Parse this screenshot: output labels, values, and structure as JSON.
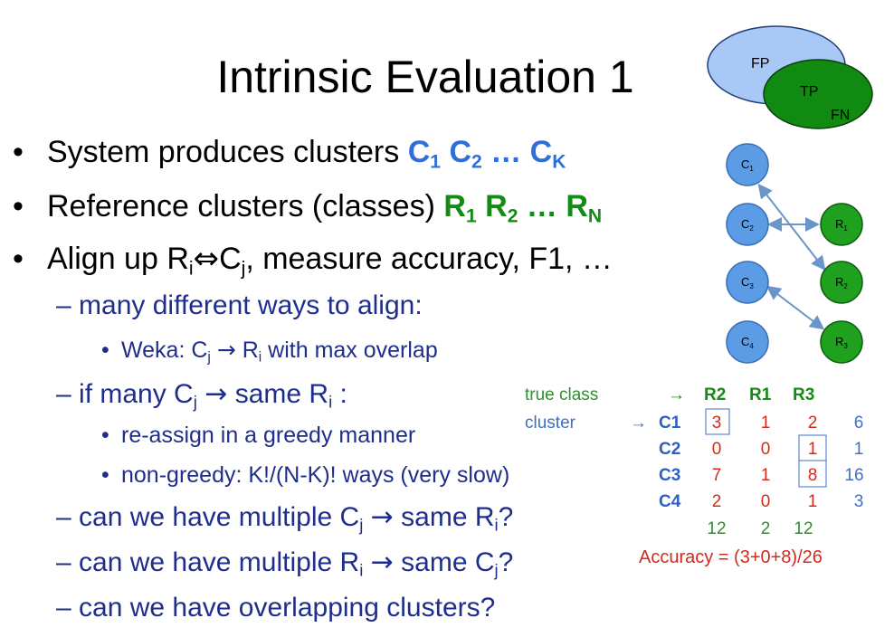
{
  "title": "Intrinsic Evaluation 1",
  "bullets": {
    "b1": {
      "text": "System produces clusters ",
      "c1": "C",
      "s1": "1",
      "c2": "C",
      "s2": "2",
      "ell": "…",
      "ck": "C",
      "sk": "K"
    },
    "b2": {
      "text": "Reference clusters (classes) ",
      "r1": "R",
      "s1": "1",
      "r2": "R",
      "s2": "2",
      "ell": "…",
      "rn": "R",
      "sn": "N"
    },
    "b3": {
      "pre": "Align up R",
      "si": "i",
      "arrow": "⇔",
      "c": "C",
      "sj": "j",
      "post": ", measure accuracy, F1, …"
    },
    "s1": {
      "text": "many different ways to align:"
    },
    "s1a": {
      "pre": "Weka: C",
      "sj": "j",
      "arrow": "→",
      "mid": " R",
      "si": "i",
      "post": " with max overlap"
    },
    "s2": {
      "pre": "if many C",
      "sj": "j",
      "arrow": "→",
      "mid": " same R",
      "si": "i",
      "post": " :"
    },
    "s2a": {
      "text": "re-assign in a greedy manner"
    },
    "s2b": {
      "text": "non-greedy: K!/(N-K)! ways (very slow)"
    },
    "s3": {
      "pre": "can we have multiple C",
      "sj": "j",
      "arrow": "→",
      "mid": " same R",
      "si": "i",
      "post": "?"
    },
    "s4": {
      "pre": "can we have multiple R",
      "si": "i",
      "arrow": "→",
      "mid": " same C",
      "sj": "j",
      "post": "?"
    },
    "s5": {
      "text": "can we have overlapping clusters?"
    }
  },
  "venn": {
    "fp": "FP",
    "tp": "TP",
    "fn": "FN"
  },
  "graph": {
    "c_nodes": [
      "C",
      "C",
      "C",
      "C"
    ],
    "c_subs": [
      "1",
      "2",
      "3",
      "4"
    ],
    "r_nodes": [
      "R",
      "R",
      "R"
    ],
    "r_subs": [
      "1",
      "2",
      "3"
    ],
    "colors": {
      "c_fill": "#5b9ce4",
      "r_fill": "#1fa01f",
      "edge": "#6a95c8"
    }
  },
  "table": {
    "header_label": "true class",
    "header_arrow": "→",
    "row_label": "cluster",
    "row_arrow": "→",
    "cols": [
      "R2",
      "R1",
      "R3"
    ],
    "rows": [
      {
        "name": "C1",
        "vals": [
          "3",
          "1",
          "2"
        ],
        "total": "6"
      },
      {
        "name": "C2",
        "vals": [
          "0",
          "0",
          "1"
        ],
        "total": "1"
      },
      {
        "name": "C3",
        "vals": [
          "7",
          "1",
          "8"
        ],
        "total": "16"
      },
      {
        "name": "C4",
        "vals": [
          "2",
          "0",
          "1"
        ],
        "total": "3"
      }
    ],
    "col_totals": [
      "12",
      "2",
      "12"
    ],
    "accuracy": "Accuracy = (3+0+8)/26"
  },
  "colors": {
    "blue_text": "#2e6fd8",
    "green_text": "#148b14",
    "sub_text": "#1f2e8a",
    "red": "#d42a1a"
  }
}
